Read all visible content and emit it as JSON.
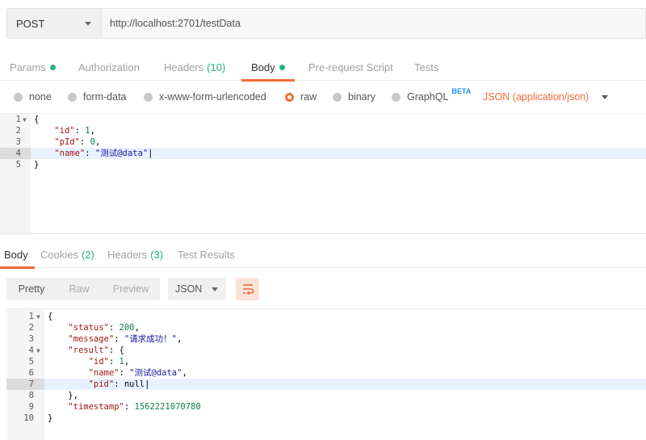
{
  "request": {
    "method": "POST",
    "url": "http://localhost:2701/testData",
    "tabs": [
      {
        "label": "Params",
        "count": ""
      },
      {
        "label": "Authorization",
        "count": ""
      },
      {
        "label": "Headers",
        "count": "(10)"
      },
      {
        "label": "Body",
        "count": ""
      },
      {
        "label": "Pre-request Script",
        "count": ""
      },
      {
        "label": "Tests",
        "count": ""
      }
    ],
    "active_tab": "Body",
    "body_types": [
      "none",
      "form-data",
      "x-www-form-urlencoded",
      "raw",
      "binary",
      "GraphQL"
    ],
    "selected_body_type": "raw",
    "graphql_badge": "BETA",
    "content_type": "JSON (application/json)",
    "body_lines": [
      "{",
      "    \"id\": 1,",
      "    \"pId\": 0,",
      "    \"name\": \"测试@data\"",
      "}"
    ]
  },
  "response": {
    "tabs": [
      {
        "label": "Body",
        "count": ""
      },
      {
        "label": "Cookies",
        "count": "(2)"
      },
      {
        "label": "Headers",
        "count": "(3)"
      },
      {
        "label": "Test Results",
        "count": ""
      }
    ],
    "active_tab": "Body",
    "view_modes": [
      "Pretty",
      "Raw",
      "Preview"
    ],
    "active_view_mode": "Pretty",
    "format": "JSON",
    "body_lines": [
      "{",
      "    \"status\": 200,",
      "    \"message\": \"请求成功！\",",
      "    \"result\": {",
      "        \"id\": 1,",
      "        \"name\": \"测试@data\",",
      "        \"pid\": null",
      "    },",
      "    \"timestamp\": 1562221070780",
      "}"
    ]
  },
  "colors": {
    "accent": "#f26b3a",
    "count_green": "#26b47f",
    "beta_blue": "#1f8ded"
  }
}
